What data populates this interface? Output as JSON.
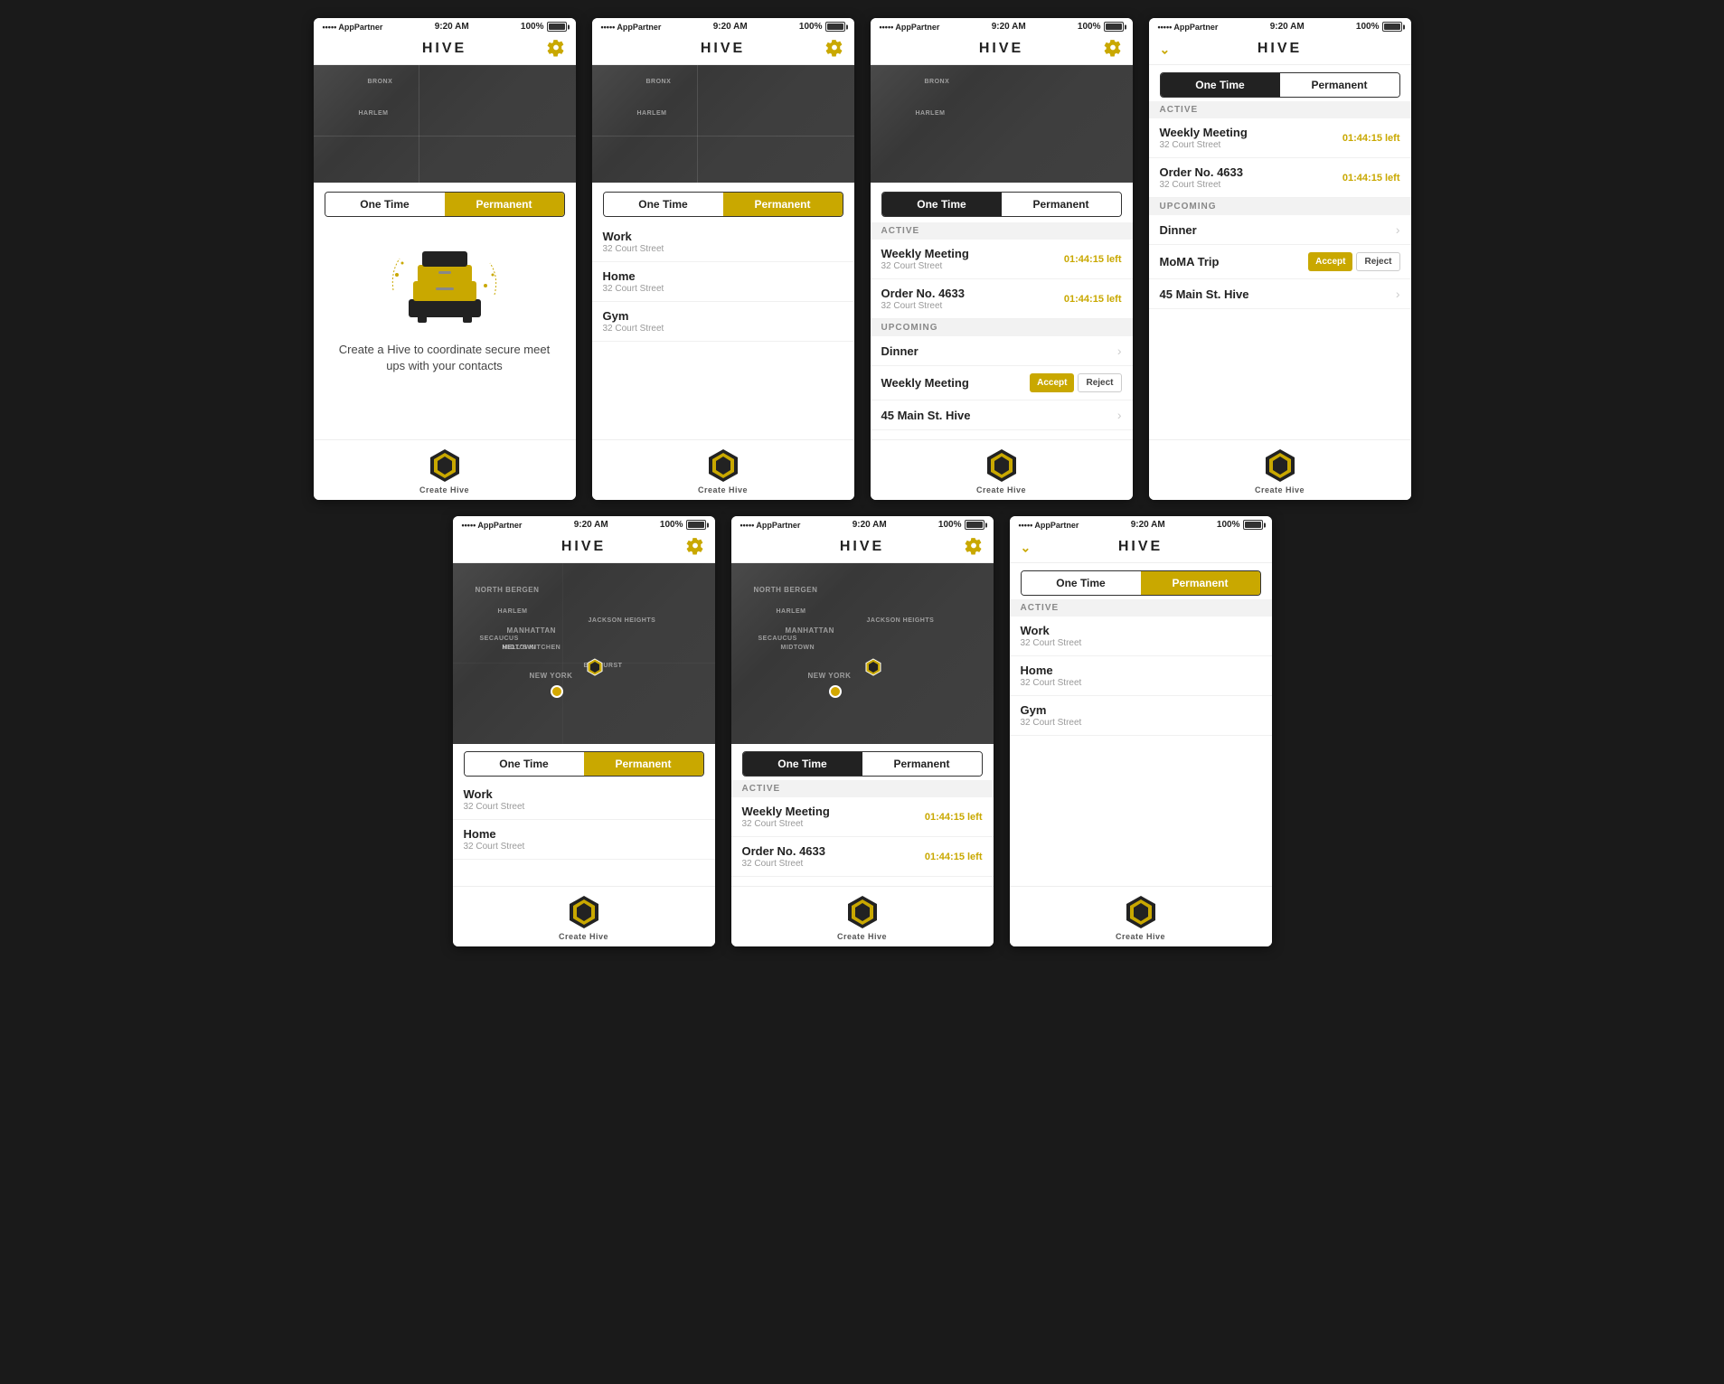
{
  "app": {
    "title": "HIVE",
    "status": {
      "dots": "•••••",
      "carrier": "AppPartner",
      "time": "9:20 AM",
      "battery": "100%"
    }
  },
  "screens": [
    {
      "id": "screen-1",
      "toggle": {
        "left": "One Time",
        "right": "Permanent",
        "active": "right"
      },
      "state": "empty",
      "emptyText": "Create a Hive to coordinate secure meet ups with your contacts",
      "bottomLabel": "Create Hive"
    },
    {
      "id": "screen-2",
      "toggle": {
        "left": "One Time",
        "right": "Permanent",
        "active": "right"
      },
      "state": "permanent-list",
      "items": [
        {
          "title": "Work",
          "sub": "32 Court Street"
        },
        {
          "title": "Home",
          "sub": "32 Court Street"
        },
        {
          "title": "Gym",
          "sub": "32 Court Street"
        }
      ],
      "bottomLabel": "Create Hive"
    },
    {
      "id": "screen-3",
      "toggle": {
        "left": "One Time",
        "right": "Permanent",
        "active": "left"
      },
      "state": "onetime-list",
      "active": [
        {
          "title": "Weekly Meeting",
          "sub": "32 Court Street",
          "timer": "01:44:15 left"
        },
        {
          "title": "Order No. 4633",
          "sub": "32 Court Street",
          "timer": "01:44:15 left"
        }
      ],
      "upcoming": [
        {
          "title": "Dinner",
          "type": "chevron"
        },
        {
          "title": "Weekly Meeting",
          "type": "accept-reject"
        },
        {
          "title": "45 Main St. Hive",
          "type": "chevron"
        }
      ],
      "bottomLabel": "Create Hive"
    },
    {
      "id": "screen-4",
      "toggle": {
        "left": "One Time",
        "right": "Permanent",
        "active": "left"
      },
      "state": "onetime-list",
      "hasChevron": true,
      "active": [
        {
          "title": "Weekly Meeting",
          "sub": "32 Court Street",
          "timer": "01:44:15 left"
        },
        {
          "title": "Order No. 4633",
          "sub": "32 Court Street",
          "timer": "01:44:15 left"
        }
      ],
      "upcoming": [
        {
          "title": "Dinner",
          "type": "chevron"
        },
        {
          "title": "MoMA Trip",
          "type": "accept-reject"
        },
        {
          "title": "45 Main St. Hive",
          "type": "chevron"
        }
      ],
      "bottomLabel": "Create Hive"
    },
    {
      "id": "screen-5",
      "toggle": {
        "left": "One Time",
        "right": "Permanent",
        "active": "right"
      },
      "state": "map-permanent",
      "items": [
        {
          "title": "Work",
          "sub": "32 Court Street"
        },
        {
          "title": "Home",
          "sub": "32 Court Street"
        }
      ],
      "bottomLabel": "Create Hive"
    },
    {
      "id": "screen-6",
      "toggle": {
        "left": "One Time",
        "right": "Permanent",
        "active": "left"
      },
      "state": "map-onetime",
      "active": [
        {
          "title": "Weekly Meeting",
          "sub": "32 Court Street",
          "timer": "01:44:15 left"
        },
        {
          "title": "Order No. 4633",
          "sub": "32 Court Street",
          "timer": "01:44:15 left"
        }
      ],
      "bottomLabel": "Create Hive"
    },
    {
      "id": "screen-7",
      "toggle": {
        "left": "One Time",
        "right": "Permanent",
        "active": "right"
      },
      "state": "permanent-list",
      "hasChevron": true,
      "items": [
        {
          "title": "Work",
          "sub": "32 Court Street"
        },
        {
          "title": "Home",
          "sub": "32 Court Street"
        },
        {
          "title": "Gym",
          "sub": "32 Court Street"
        }
      ],
      "bottomLabel": "Create Hive",
      "sectionLabel": "ACTIVE"
    }
  ],
  "labels": {
    "active": "ACTIVE",
    "upcoming": "UPCOMING",
    "one_time": "One Time",
    "permanent": "Permanent",
    "accept": "Accept",
    "reject": "Reject",
    "create_hive": "Create Hive",
    "timer_suffix": " left"
  }
}
